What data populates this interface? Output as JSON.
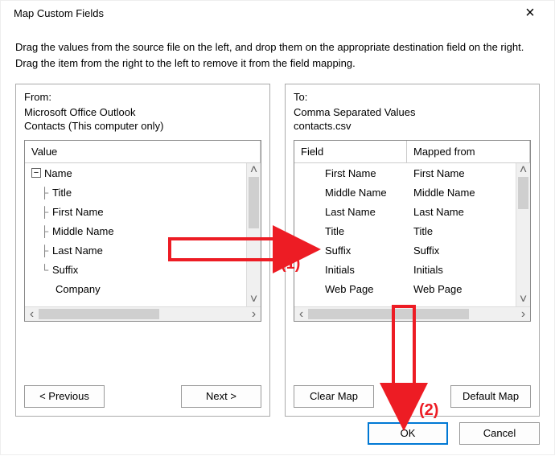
{
  "title": "Map Custom Fields",
  "instructions": "Drag the values from the source file on the left, and drop them on the appropriate destination field on the right.  Drag the item from the right to the left to remove it from the field mapping.",
  "from": {
    "label": "From:",
    "source": "Microsoft Office Outlook",
    "subset": "Contacts (This computer only)",
    "header_value": "Value",
    "tree": {
      "root_label": "Name",
      "children": [
        "Title",
        "First Name",
        "Middle Name",
        "Last Name",
        "Suffix"
      ],
      "extra": "Company"
    }
  },
  "to": {
    "label": "To:",
    "dest": "Comma Separated Values",
    "file": "contacts.csv",
    "header_field": "Field",
    "header_mapped": "Mapped from",
    "rows": [
      {
        "field": "First Name",
        "mapped": "First Name"
      },
      {
        "field": "Middle Name",
        "mapped": "Middle Name"
      },
      {
        "field": "Last Name",
        "mapped": "Last Name"
      },
      {
        "field": "Title",
        "mapped": "Title"
      },
      {
        "field": "Suffix",
        "mapped": "Suffix"
      },
      {
        "field": "Initials",
        "mapped": "Initials"
      },
      {
        "field": "Web Page",
        "mapped": "Web Page"
      }
    ]
  },
  "buttons": {
    "previous": "< Previous",
    "next": "Next >",
    "clear_map": "Clear Map",
    "default_map": "Default Map",
    "ok": "OK",
    "cancel": "Cancel"
  },
  "annotations": {
    "label1": "(1)",
    "label2": "(2)"
  }
}
